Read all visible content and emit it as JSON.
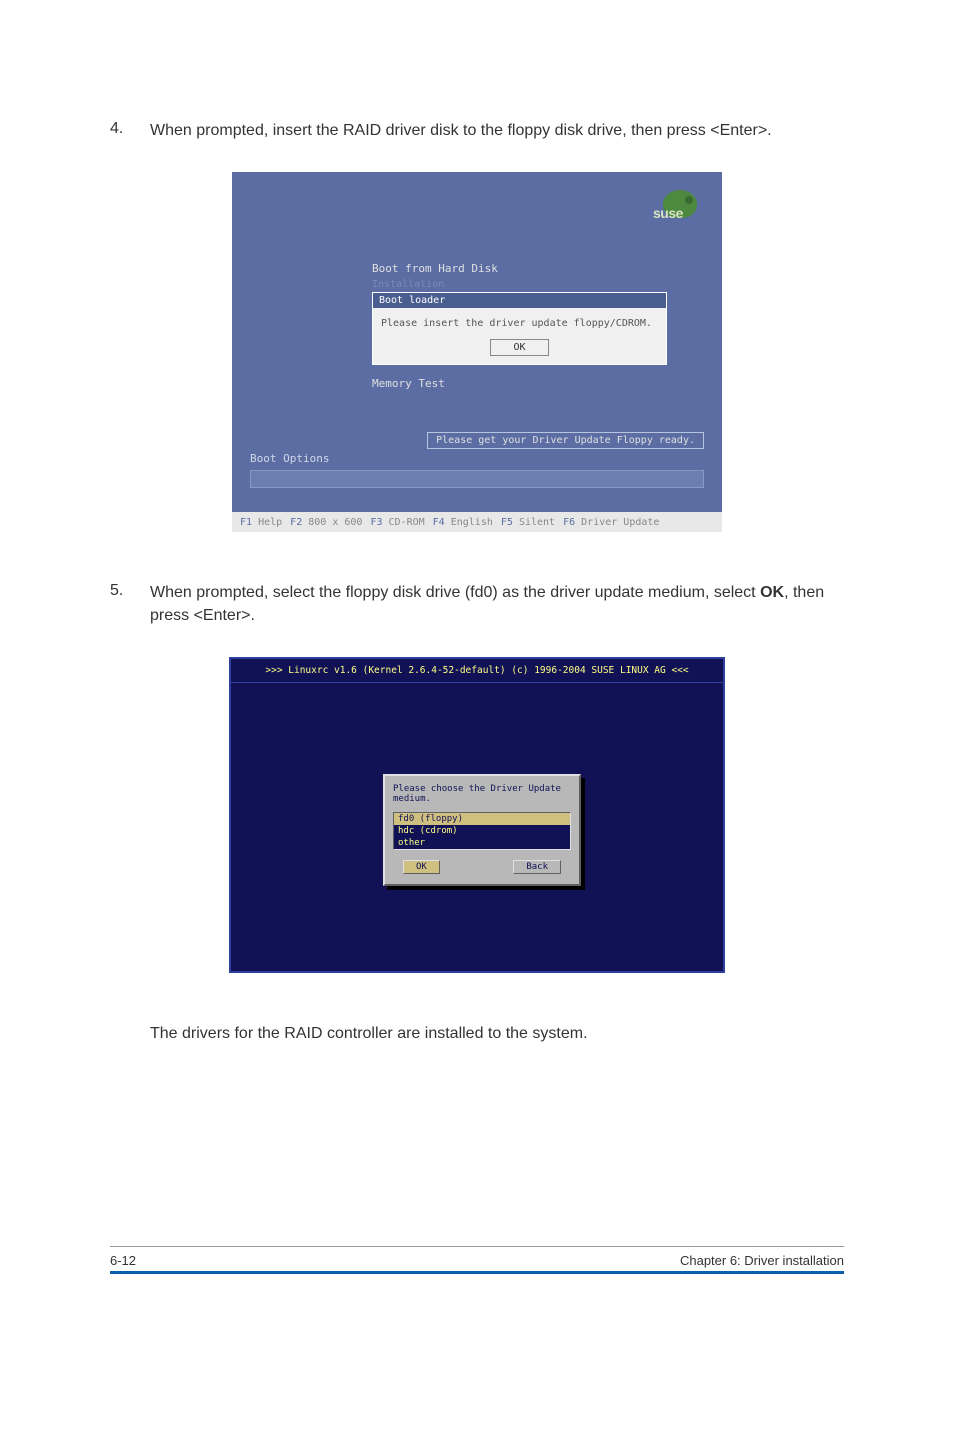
{
  "steps": {
    "s4": {
      "num": "4.",
      "text_before": "When prompted, insert the RAID driver disk to the floppy disk drive, then press <Enter>.",
      "text_after": ""
    },
    "s5": {
      "num": "5.",
      "text_before": "When prompted, select the floppy disk drive (fd0) as the driver update medium, select ",
      "bold": "OK",
      "text_after": ", then press <Enter>."
    }
  },
  "suse": {
    "logo_text": "suse",
    "menu": {
      "boot_hd": "Boot from Hard Disk",
      "installation": "Installation"
    },
    "dialog": {
      "title": "Boot loader",
      "msg": "Please insert the driver update floppy/CDROM.",
      "ok": "OK"
    },
    "memory_test": "Memory Test",
    "driver_ready": "Please get your Driver Update Floppy ready.",
    "boot_options_label": "Boot Options",
    "fkeys": {
      "f1k": "F1",
      "f1l": "Help",
      "f2k": "F2",
      "f2l": "800 x 600",
      "f3k": "F3",
      "f3l": "CD-ROM",
      "f4k": "F4",
      "f4l": "English",
      "f5k": "F5",
      "f5l": "Silent",
      "f6k": "F6",
      "f6l": "Driver Update"
    }
  },
  "linuxrc": {
    "header": ">>> Linuxrc v1.6 (Kernel 2.6.4-52-default) (c) 1996-2004 SUSE LINUX AG <<<",
    "prompt": "Please choose the Driver Update medium.",
    "options": {
      "opt0": "fd0 (floppy)",
      "opt1": "hdc (cdrom)",
      "opt2": "other"
    },
    "buttons": {
      "ok": "OK",
      "back": "Back"
    }
  },
  "final_note": "The drivers for the RAID controller are installed to the system.",
  "footer": {
    "left": "6-12",
    "right": "Chapter 6: Driver installation"
  }
}
